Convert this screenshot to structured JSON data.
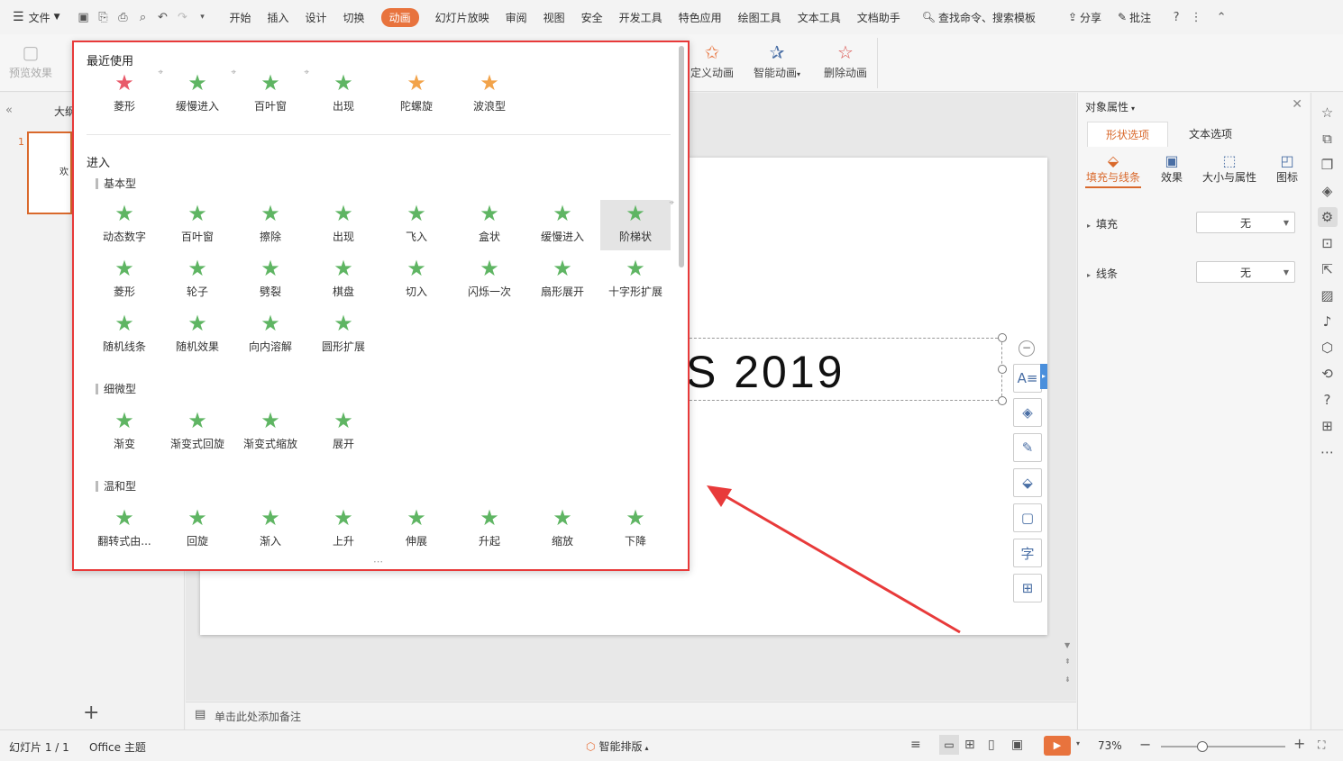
{
  "menubar": {
    "file": "文件",
    "tabs": [
      "开始",
      "插入",
      "设计",
      "切换",
      "动画",
      "幻灯片放映",
      "审阅",
      "视图",
      "安全",
      "开发工具",
      "特色应用",
      "绘图工具",
      "文本工具",
      "文档助手"
    ],
    "search": "查找命令、搜索模板",
    "share": "分享",
    "comment": "批注"
  },
  "ribbon": {
    "preview": "预览效果",
    "custom_anim": "定义动画",
    "smart_anim": "智能动画",
    "delete_anim": "删除动画"
  },
  "leftpanel": {
    "outline_tab": "大纲",
    "slide_number": "1",
    "thumb_text": "欢"
  },
  "slide": {
    "title_text": "S 2019"
  },
  "notes": {
    "placeholder": "单击此处添加备注"
  },
  "popup": {
    "recent_title": "最近使用",
    "recent": [
      "菱形",
      "缓慢进入",
      "百叶窗",
      "出现",
      "陀螺旋",
      "波浪型"
    ],
    "enter_title": "进入",
    "basic_title": "基本型",
    "basic": [
      "动态数字",
      "百叶窗",
      "擦除",
      "出现",
      "飞入",
      "盒状",
      "缓慢进入",
      "阶梯状",
      "菱形",
      "轮子",
      "劈裂",
      "棋盘",
      "切入",
      "闪烁一次",
      "扇形展开",
      "十字形扩展",
      "随机线条",
      "随机效果",
      "向内溶解",
      "圆形扩展"
    ],
    "subtle_title": "细微型",
    "subtle": [
      "渐变",
      "渐变式回旋",
      "渐变式缩放",
      "展开"
    ],
    "moderate_title": "温和型",
    "moderate": [
      "翻转式由...",
      "回旋",
      "渐入",
      "上升",
      "伸展",
      "升起",
      "缩放",
      "下降"
    ],
    "resize_handle": "⋯"
  },
  "rightpane": {
    "title": "对象属性",
    "tabs": [
      "形状选项",
      "文本选项"
    ],
    "subtabs": [
      "填充与线条",
      "效果",
      "大小与属性",
      "图标"
    ],
    "fill_label": "填充",
    "fill_value": "无",
    "line_label": "线条",
    "line_value": "无"
  },
  "statusbar": {
    "slide_info": "幻灯片 1 / 1",
    "theme": "Office 主题",
    "smart_layout": "智能排版",
    "zoom": "73%"
  },
  "colors": {
    "accent": "#e8733d",
    "popup_border": "#e83a3a",
    "star_green": "#5fb563",
    "star_orange": "#f2a34a",
    "arrow_red": "#e83a3a"
  }
}
